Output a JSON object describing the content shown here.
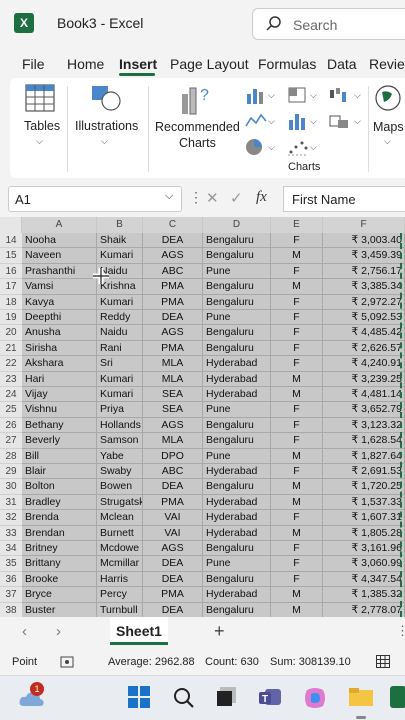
{
  "window": {
    "app_icon_letter": "X",
    "title": "Book3  -  Excel"
  },
  "search": {
    "placeholder": "Search"
  },
  "ribbon_tabs": [
    "File",
    "Home",
    "Insert",
    "Page Layout",
    "Formulas",
    "Data",
    "Review"
  ],
  "active_tab": "Insert",
  "ribbon": {
    "tables_label": "Tables",
    "illustrations_label": "Illustrations",
    "recommended_charts_label1": "Recommended",
    "recommended_charts_label2": "Charts",
    "charts_group_label": "Charts",
    "maps_label": "Maps"
  },
  "formula_bar": {
    "name_box": "A1",
    "fx_label": "fx",
    "content": "First Name"
  },
  "columns": [
    "A",
    "B",
    "C",
    "D",
    "E",
    "F"
  ],
  "rows": [
    {
      "n": "14",
      "a": "Nooha",
      "b": "Shaik",
      "c": "DEA",
      "d": "Bengaluru",
      "e": "F",
      "f": "₹ 3,003.40"
    },
    {
      "n": "15",
      "a": "Naveen",
      "b": "Kumari",
      "c": "AGS",
      "d": "Bengaluru",
      "e": "M",
      "f": "₹ 3,459.39"
    },
    {
      "n": "16",
      "a": "Prashanthi",
      "b": "Naidu",
      "c": "ABC",
      "d": "Pune",
      "e": "F",
      "f": "₹ 2,756.17"
    },
    {
      "n": "17",
      "a": "Vamsi",
      "b": "Krishna",
      "c": "PMA",
      "d": "Bengaluru",
      "e": "M",
      "f": "₹ 3,385.34"
    },
    {
      "n": "18",
      "a": "Kavya",
      "b": "Kumari",
      "c": "PMA",
      "d": "Bengaluru",
      "e": "F",
      "f": "₹ 2,972.27"
    },
    {
      "n": "19",
      "a": "Deepthi",
      "b": "Reddy",
      "c": "DEA",
      "d": "Pune",
      "e": "F",
      "f": "₹ 5,092.53"
    },
    {
      "n": "20",
      "a": "Anusha",
      "b": "Naidu",
      "c": "AGS",
      "d": "Bengaluru",
      "e": "F",
      "f": "₹ 4,485.42"
    },
    {
      "n": "21",
      "a": "Sirisha",
      "b": "Rani",
      "c": "PMA",
      "d": "Bengaluru",
      "e": "F",
      "f": "₹ 2,626.57"
    },
    {
      "n": "22",
      "a": "Akshara",
      "b": "Sri",
      "c": "MLA",
      "d": "Hyderabad",
      "e": "F",
      "f": "₹ 4,240.91"
    },
    {
      "n": "23",
      "a": "Hari",
      "b": "Kumari",
      "c": "MLA",
      "d": "Hyderabad",
      "e": "M",
      "f": "₹ 3,239.25"
    },
    {
      "n": "24",
      "a": "Vijay",
      "b": "Kumari",
      "c": "SEA",
      "d": "Hyderabad",
      "e": "M",
      "f": "₹ 4,481.14"
    },
    {
      "n": "25",
      "a": "Vishnu",
      "b": "Priya",
      "c": "SEA",
      "d": "Pune",
      "e": "F",
      "f": "₹ 3,652.79"
    },
    {
      "n": "26",
      "a": "Bethany",
      "b": "Hollands",
      "c": "AGS",
      "d": "Bengaluru",
      "e": "F",
      "f": "₹ 3,123.32"
    },
    {
      "n": "27",
      "a": "Beverly",
      "b": "Samson",
      "c": "MLA",
      "d": "Bengaluru",
      "e": "F",
      "f": "₹ 1,628.54"
    },
    {
      "n": "28",
      "a": "Bill",
      "b": "Yabe",
      "c": "DPO",
      "d": "Pune",
      "e": "M",
      "f": "₹ 1,827.64"
    },
    {
      "n": "29",
      "a": "Blair",
      "b": "Swaby",
      "c": "ABC",
      "d": "Hyderabad",
      "e": "F",
      "f": "₹ 2,691.53"
    },
    {
      "n": "30",
      "a": "Bolton",
      "b": "Bowen",
      "c": "DEA",
      "d": "Bengaluru",
      "e": "M",
      "f": "₹ 1,720.25"
    },
    {
      "n": "31",
      "a": "Bradley",
      "b": "Strugatsk",
      "c": "PMA",
      "d": "Hyderabad",
      "e": "M",
      "f": "₹ 1,537.33"
    },
    {
      "n": "32",
      "a": "Brenda",
      "b": "Mclean",
      "c": "VAI",
      "d": "Hyderabad",
      "e": "F",
      "f": "₹ 1,607.31"
    },
    {
      "n": "33",
      "a": "Brendan",
      "b": "Burnett",
      "c": "VAI",
      "d": "Hyderabad",
      "e": "M",
      "f": "₹ 1,805.28"
    },
    {
      "n": "34",
      "a": "Britney",
      "b": "Mcdowe",
      "c": "AGS",
      "d": "Bengaluru",
      "e": "F",
      "f": "₹ 3,161.96"
    },
    {
      "n": "35",
      "a": "Brittany",
      "b": "Mcmillar",
      "c": "DEA",
      "d": "Pune",
      "e": "F",
      "f": "₹ 3,060.99"
    },
    {
      "n": "36",
      "a": "Brooke",
      "b": "Harris",
      "c": "DEA",
      "d": "Bengaluru",
      "e": "F",
      "f": "₹ 4,347.54"
    },
    {
      "n": "37",
      "a": "Bryce",
      "b": "Percy",
      "c": "PMA",
      "d": "Hyderabad",
      "e": "M",
      "f": "₹ 1,385.32"
    },
    {
      "n": "38",
      "a": "Buster",
      "b": "Turnbull",
      "c": "DEA",
      "d": "Bengaluru",
      "e": "M",
      "f": "₹ 2,778.07"
    }
  ],
  "sheet": {
    "name": "Sheet1",
    "add": "+"
  },
  "status": {
    "mode": "Point",
    "average": "Average: 2962.88",
    "count": "Count: 630",
    "sum": "Sum: 308139.10"
  },
  "taskbar": {
    "notification_badge": "1"
  },
  "colors": {
    "excel_green": "#1d6f42",
    "selection_gray": "#c8c8c8"
  }
}
